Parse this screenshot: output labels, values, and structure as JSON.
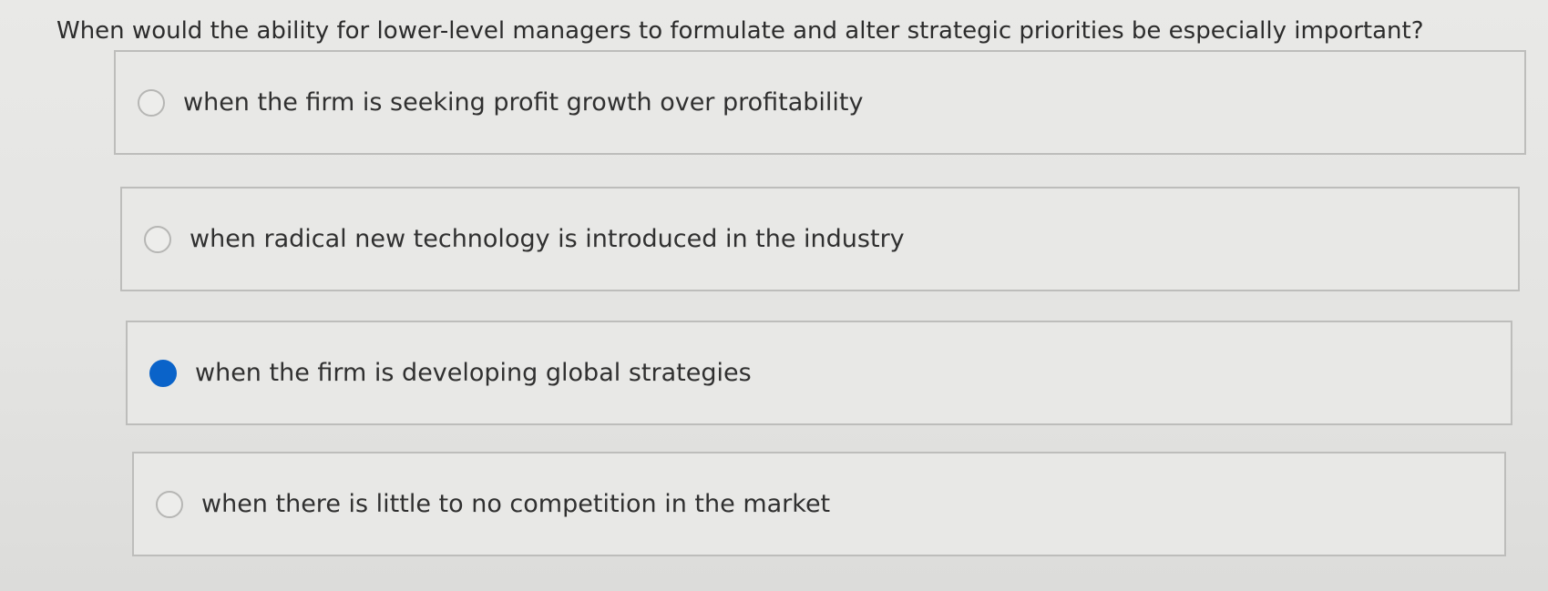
{
  "question": {
    "text": "When would the ability for lower-level managers to formulate and alter strategic priorities be especially important?"
  },
  "options": [
    {
      "label": "when the firm is seeking profit growth over profitability",
      "selected": false
    },
    {
      "label": "when radical new technology is introduced in the industry",
      "selected": false
    },
    {
      "label": "when the firm is developing global strategies",
      "selected": true
    },
    {
      "label": "when there is little to no competition in the market",
      "selected": false
    }
  ],
  "colors": {
    "selected_radio": "#0a63c9",
    "option_border": "#bdbdbb",
    "background": "#e6e6e4"
  }
}
